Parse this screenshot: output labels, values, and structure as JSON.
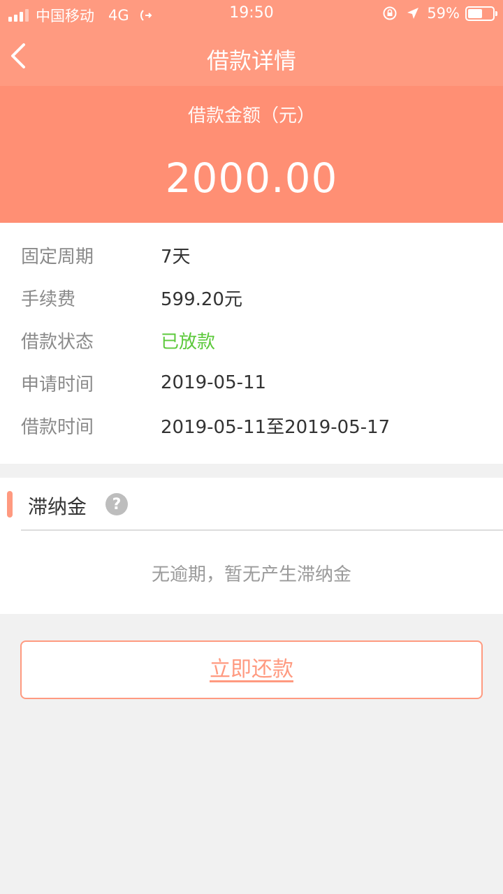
{
  "status_bar": {
    "carrier": "中国移动",
    "network": "4G",
    "time": "19:50",
    "battery_percent": "59%",
    "battery_level": 0.59
  },
  "nav": {
    "title": "借款详情",
    "back_icon": "chevron-left-icon"
  },
  "hero": {
    "label": "借款金额（元）",
    "amount": "2000.00"
  },
  "details": [
    {
      "label": "固定周期",
      "value": "7天"
    },
    {
      "label": "手续费",
      "value": "599.20元"
    },
    {
      "label": "借款状态",
      "value": "已放款"
    },
    {
      "label": "申请时间",
      "value": "2019-05-11"
    },
    {
      "label": "借款时间",
      "value": "2019-05-11至2019-05-17"
    }
  ],
  "late_fee": {
    "title": "滞纳金",
    "help_icon": "question-icon",
    "empty_text": "无逾期，暂无产生滞纳金"
  },
  "actions": {
    "repay_label": "立即还款"
  },
  "colors": {
    "header": "#ff9a80",
    "hero": "#ff8f74",
    "status_green": "#5cc93b",
    "background": "#f1f1f1"
  }
}
